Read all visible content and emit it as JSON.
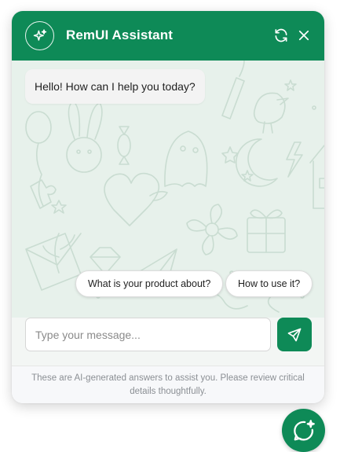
{
  "header": {
    "title": "RemUI Assistant",
    "avatar_icon": "sparkles-icon",
    "refresh_icon": "refresh-icon",
    "close_icon": "close-icon"
  },
  "messages": [
    {
      "role": "bot",
      "text": "Hello! How can I help you today?"
    }
  ],
  "suggestions": [
    {
      "label": "What is your product about?"
    },
    {
      "label": "How to use it?"
    }
  ],
  "composer": {
    "placeholder": "Type your message...",
    "value": "",
    "send_icon": "send-icon"
  },
  "footer": {
    "disclaimer": "These are AI-generated answers to assist you. Please review critical details thoughtfully."
  },
  "launcher": {
    "icon": "chat-sparkle-icon"
  },
  "colors": {
    "brand": "#0e8a57",
    "chat_background": "#e7f1eb",
    "bubble": "#f3f3f3",
    "footer_text": "#8b8f94"
  }
}
